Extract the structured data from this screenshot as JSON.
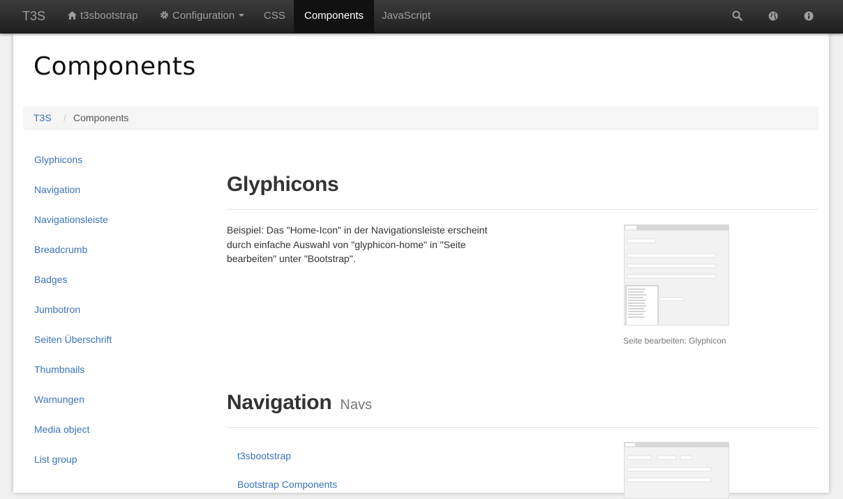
{
  "navbar": {
    "brand": "T3S",
    "items": [
      {
        "label": "t3sbootstrap",
        "icon": "home-icon"
      },
      {
        "label": "Configuration",
        "icon": "gear-icon"
      },
      {
        "label": "CSS"
      },
      {
        "label": "Components"
      },
      {
        "label": "JavaScript"
      }
    ],
    "active_item": "Components",
    "right_icons": [
      "search-icon",
      "globe-icon",
      "info-icon"
    ]
  },
  "page": {
    "title": "Components"
  },
  "breadcrumb": {
    "root": "T3S",
    "separator": "/",
    "current": "Components"
  },
  "sidebar": {
    "items": [
      "Glyphicons",
      "Navigation",
      "Navigationsleiste",
      "Breadcrumb",
      "Badges",
      "Jumbotron",
      "Seiten Überschrift",
      "Thumbnails",
      "Warnungen",
      "Media object",
      "List group"
    ]
  },
  "glyphicons": {
    "title": "Glyphicons",
    "text": "Beispiel: Das \"Home-Icon\" in der Navigationsleiste erscheint durch einfache Auswahl von \"glyphicon-home\" in \"Seite bearbeiten\" unter \"Bootstrap\".",
    "caption": "Seite bearbeiten: Glyphicon"
  },
  "navigation": {
    "title": "Navigation",
    "subtitle": "Navs",
    "links": [
      "t3sbootstrap",
      "Bootstrap Components"
    ]
  },
  "colors": {
    "link": "#3b73b9",
    "navbar_bg": "#222222",
    "active_nav_bg": "#111111",
    "breadcrumb_bg": "#f5f5f5"
  }
}
